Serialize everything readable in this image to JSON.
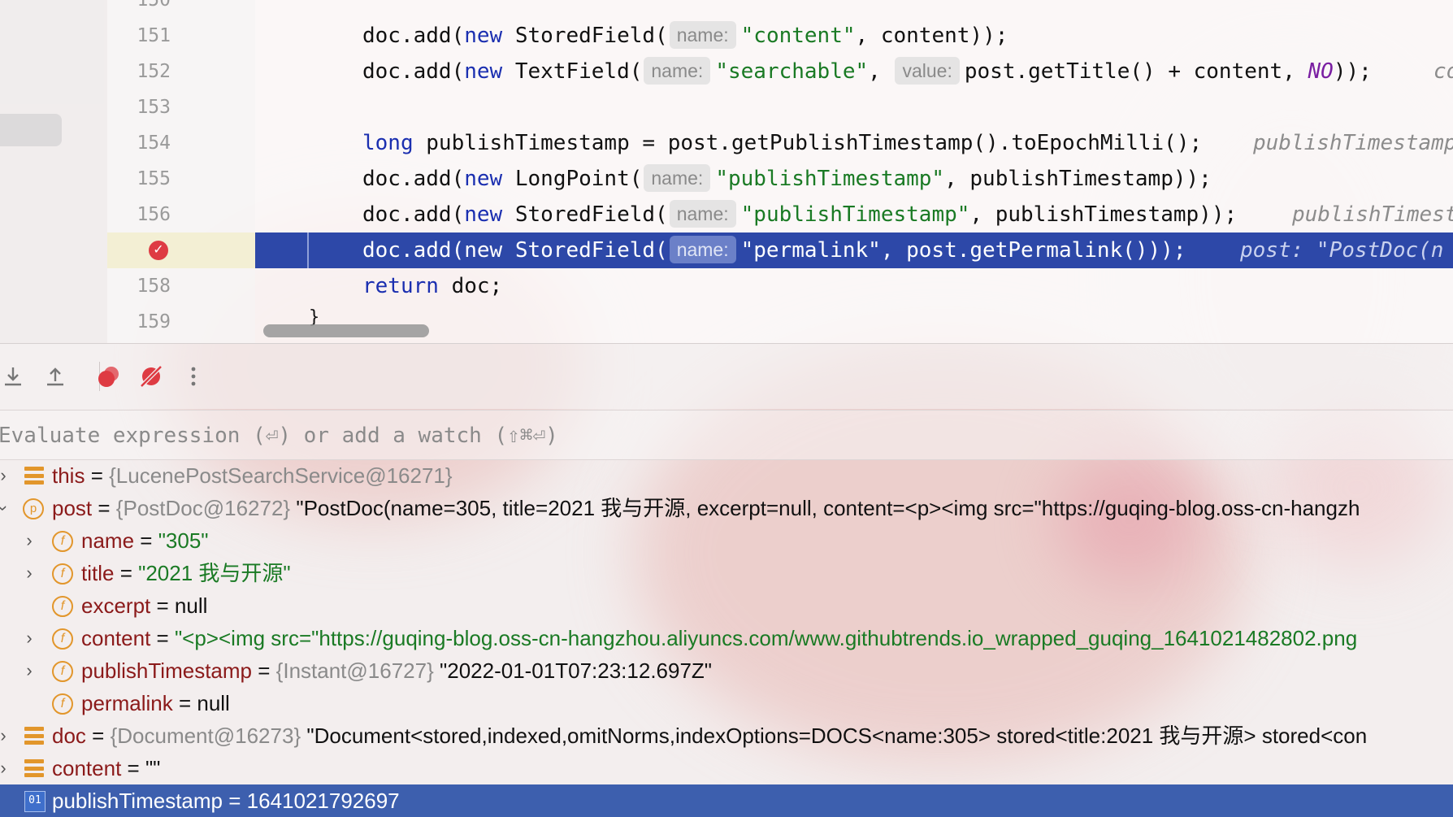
{
  "editor": {
    "partial_top_line_number": "150",
    "lines": [
      {
        "num": "151",
        "pre": "doc.add(",
        "kw": "new",
        "mid": " StoredField(",
        "hint": "name:",
        "str": "\"content\"",
        "post": ", content));"
      },
      {
        "num": "152",
        "pre": "doc.add(",
        "kw": "new",
        "mid": " TextField(",
        "hint": "name:",
        "str": "\"searchable\"",
        "post": ", ",
        "hint2": "value:",
        "post2": "post.getTitle() + content, ",
        "const": "NO",
        "post3": "));",
        "inline": "co"
      },
      {
        "num": "153"
      },
      {
        "num": "154",
        "kw": "long",
        "mid": " publishTimestamp = post.getPublishTimestamp().toEpochMilli();",
        "inline": "publishTimestamp"
      },
      {
        "num": "155",
        "pre": "doc.add(",
        "kw": "new",
        "mid": " LongPoint(",
        "hint": "name:",
        "str": "\"publishTimestamp\"",
        "post": ", publishTimestamp));"
      },
      {
        "num": "156",
        "pre": "doc.add(",
        "kw": "new",
        "mid": " StoredField(",
        "hint": "name:",
        "str": "\"publishTimestamp\"",
        "post": ", publishTimestamp));",
        "inline": "publishTimest"
      },
      {
        "pre": "doc.add(new StoredField(",
        "hint": "name:",
        "str": "\"permalink\"",
        "post": ", post.getPermalink()));",
        "inline": "post: \"PostDoc(n"
      },
      {
        "num": "158",
        "kw": "return",
        "mid": " doc;"
      },
      {
        "num": "159",
        "text": "}"
      }
    ]
  },
  "toolbar": {
    "step_into_icon": "step-into-icon",
    "step_out_icon": "step-out-icon",
    "breakpoints_icon": "view-breakpoints-icon",
    "mute_icon": "mute-breakpoints-icon",
    "more_icon": "more-icon"
  },
  "evaluate": {
    "placeholder": "Evaluate expression (⏎) or add a watch (⇧⌘⏎)"
  },
  "variables": [
    {
      "name": "this",
      "eq": " = ",
      "type": "{LucenePostSearchService@16271}",
      "value": ""
    },
    {
      "name": "post",
      "eq": " = ",
      "type": "{PostDoc@16272}",
      "value": " \"PostDoc(name=305, title=2021 我与开源, excerpt=null, content=<p><img src=\"https://guqing-blog.oss-cn-hangzh"
    },
    {
      "name": "name",
      "eq": " = ",
      "value": "\"305\""
    },
    {
      "name": "title",
      "eq": " = ",
      "value": "\"2021 我与开源\""
    },
    {
      "name": "excerpt",
      "eq": " = ",
      "value": "null"
    },
    {
      "name": "content",
      "eq": " = ",
      "value": "\"<p><img src=\"https://guqing-blog.oss-cn-hangzhou.aliyuncs.com/www.githubtrends.io_wrapped_guqing_1641021482802.png"
    },
    {
      "name": "publishTimestamp",
      "eq": " = ",
      "type": "{Instant@16727}",
      "value": " \"2022-01-01T07:23:12.697Z\""
    },
    {
      "name": "permalink",
      "eq": " = ",
      "value": "null"
    },
    {
      "name": "doc",
      "eq": " = ",
      "type": "{Document@16273}",
      "value": " \"Document<stored,indexed,omitNorms,indexOptions=DOCS<name:305> stored<title:2021 我与开源> stored<con"
    },
    {
      "name": "content",
      "eq": " = ",
      "value": "\"\""
    },
    {
      "name": "publishTimestamp",
      "eq": " = ",
      "value": "1641021792697",
      "prim_badge": "01"
    }
  ],
  "colors": {
    "keyword": "#1b2fb0",
    "string": "#1a7a24",
    "constant": "#7a1fa2",
    "variable_name": "#8b1a1a",
    "current_line": "#2d48a8",
    "selected_row": "#3d5fae",
    "breakpoint": "#de3b43",
    "icon_orange": "#e2962b"
  }
}
